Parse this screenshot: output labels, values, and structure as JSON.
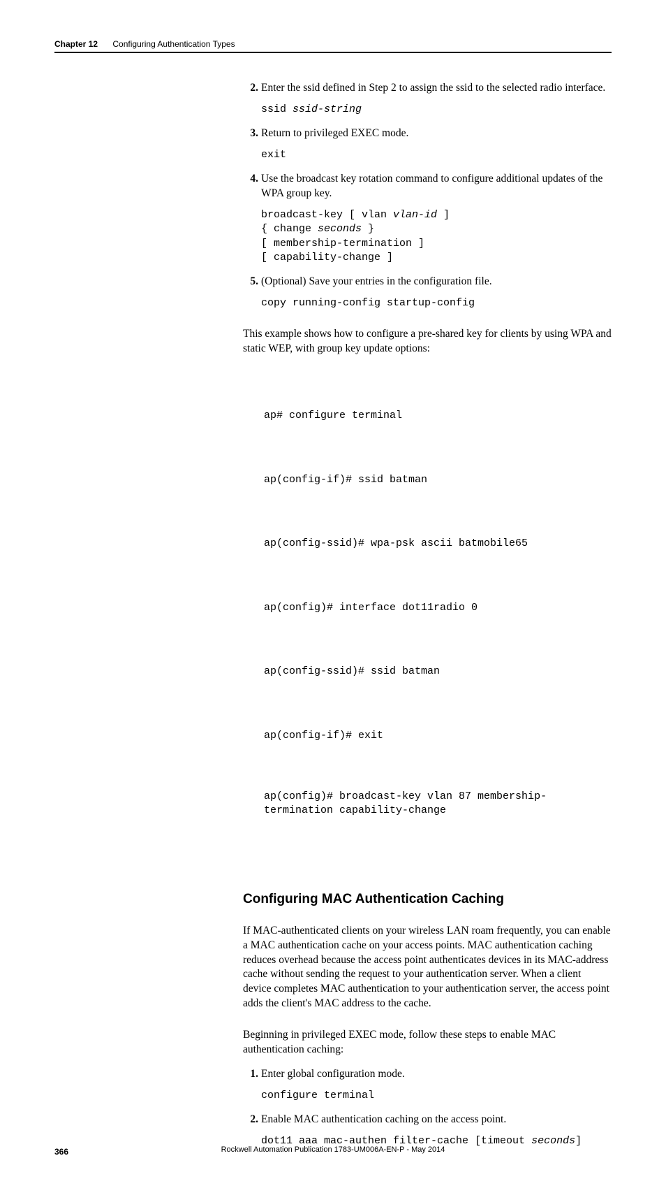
{
  "header": {
    "chapter": "Chapter 12",
    "title": "Configuring Authentication Types"
  },
  "steps_a": [
    {
      "num": "2",
      "text": "Enter the ssid defined in Step 2 to assign the ssid to the selected radio interface.",
      "code_pre": "ssid ",
      "code_it": "ssid-string",
      "code_post": ""
    },
    {
      "num": "3",
      "text": "Return to privileged EXEC mode.",
      "code_pre": "exit",
      "code_it": "",
      "code_post": ""
    },
    {
      "num": "4",
      "text": "Use the broadcast key rotation command to configure additional updates of the WPA group key.",
      "code_pre": "broadcast-key [ vlan ",
      "code_it": "vlan-id",
      "code_post": " ]\n{ change ",
      "code_it2": "seconds",
      "code_post2": " }\n[ membership-termination ]\n[ capability-change ]"
    },
    {
      "num": "5",
      "text": "(Optional) Save your entries in the configuration file.",
      "code_pre": "copy running-config startup-config",
      "code_it": "",
      "code_post": ""
    }
  ],
  "para_example_intro": "This example shows how to configure a pre-shared key for clients by using WPA and static WEP, with group key update options:",
  "example_lines": [
    "ap# configure terminal",
    "ap(config-if)# ssid batman",
    "ap(config-ssid)# wpa-psk ascii batmobile65",
    "ap(config)# interface dot11radio 0",
    "ap(config-ssid)# ssid batman",
    "ap(config-if)# exit",
    "ap(config)# broadcast-key vlan 87 membership-termination capability-change"
  ],
  "section_heading": "Configuring MAC Authentication Caching",
  "para_mac1": "If MAC-authenticated clients on your wireless LAN roam frequently, you can enable a MAC authentication cache on your access points. MAC authentication caching reduces overhead because the access point authenticates devices in its MAC-address cache without sending the request to your authentication server. When a client device completes MAC authentication to your authentication server, the access point adds the client's MAC address to the cache.",
  "para_mac2": "Beginning in privileged EXEC mode, follow these steps to enable MAC authentication caching:",
  "steps_b": [
    {
      "num": "1",
      "text": "Enter global configuration mode.",
      "code_pre": "configure terminal",
      "code_it": "",
      "code_post": ""
    },
    {
      "num": "2",
      "text": "Enable MAC authentication caching on the access point.",
      "code_pre": "dot11 aaa mac-authen filter-cache [timeout ",
      "code_it": "seconds",
      "code_post": "]"
    }
  ],
  "footer": {
    "page": "366",
    "pub": "Rockwell Automation Publication 1783-UM006A-EN-P - May 2014"
  }
}
